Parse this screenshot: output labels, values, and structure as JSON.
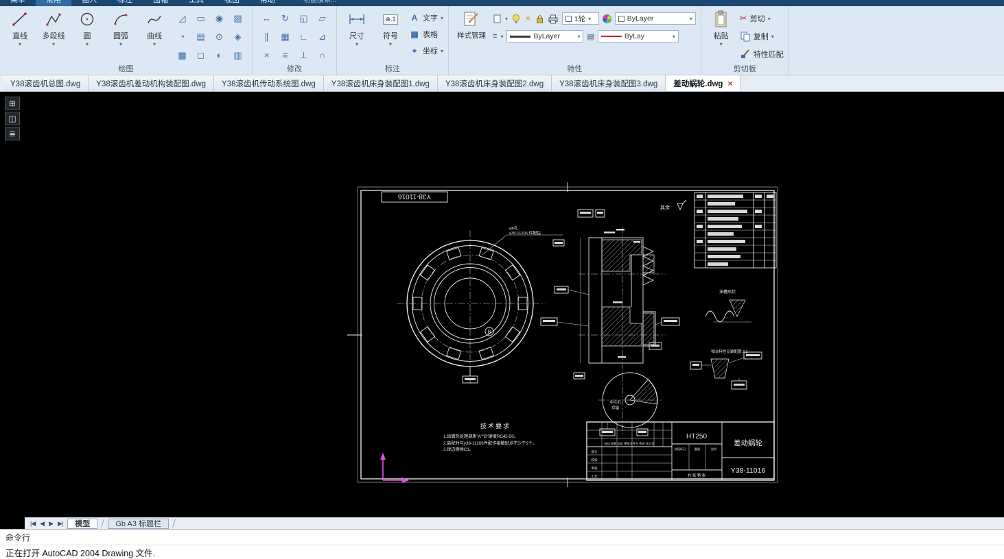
{
  "menu": {
    "items": [
      "菜单",
      "常用",
      "插入",
      "标注",
      "图幅",
      "工具",
      "视图",
      "帮助"
    ],
    "search": "功能搜索..."
  },
  "icons": {
    "dropdown": "▾",
    "close": "×",
    "scissors": "✂",
    "sun": "☀",
    "hamburger": "≡",
    "rows": "▤",
    "text_a": "A",
    "table": "▦",
    "coord": "⌖",
    "symbol": "⊕.1",
    "nav_first": "|◀",
    "nav_prev": "◀",
    "nav_next": "▶",
    "nav_last": "▶|",
    "rail": [
      "⊞",
      "◫",
      "≣"
    ],
    "draw_small": [
      "◿",
      "▭",
      "◉",
      "▨",
      "◔",
      "▤",
      "⊙",
      "◈",
      "▩",
      "◻",
      "◐",
      "▥"
    ],
    "modify_grid": [
      "↔",
      "↻",
      "◱",
      "▱",
      "∥",
      "▦",
      "∟",
      "⊿",
      "×",
      "≡",
      "⊥",
      "∩"
    ]
  },
  "ribbon": {
    "draw": {
      "label": "绘图",
      "big": [
        {
          "label": "直线"
        },
        {
          "label": "多段线"
        },
        {
          "label": "圆"
        },
        {
          "label": "圆弧"
        },
        {
          "label": "曲线"
        }
      ]
    },
    "modify": {
      "label": "修改"
    },
    "annotate": {
      "label": "标注",
      "dim": "尺寸",
      "symbol": "符号",
      "text": "文字",
      "table": "表格",
      "coord": "坐标"
    },
    "props": {
      "label": "特性",
      "style_mgr": "样式管理",
      "layer": "1轮",
      "color": "ByLayer",
      "lineweight": "ByLayer",
      "linetype": "ByLay"
    },
    "clip": {
      "label": "剪切板",
      "paste": "粘贴",
      "cut": "剪切",
      "copy": "复制",
      "match": "特性匹配"
    }
  },
  "doc_tabs": [
    {
      "label": "Y38滚齿机总图.dwg"
    },
    {
      "label": "Y38滚齿机差动机构装配图.dwg"
    },
    {
      "label": "Y38滚齿机传动系统图.dwg"
    },
    {
      "label": "Y38滚齿机床身装配图1.dwg"
    },
    {
      "label": "Y38滚齿机床身装配图2.dwg"
    },
    {
      "label": "Y38滚齿机床身装配图3.dwg"
    },
    {
      "label": "差动蜗轮.dwg",
      "active": true
    }
  ],
  "drawing": {
    "frame_label": "Y38-11016",
    "b_mark": "B",
    "leader": {
      "l1": "φ6孔",
      "l2": "y38-11206 件配钻"
    },
    "surface_note": "其余",
    "oil_groove_label": "油槽形状",
    "detail_label": "啮合特性见装配图 2:1",
    "center_hole": {
      "l1": "中心孔",
      "l2": "保留"
    },
    "tech": {
      "title": "技术要求",
      "l1": "1.齿面热处理调质\"A\"\"B\"硬度RC45-50。",
      "l2": "2.装配时与y38-11206件配作接触斑点不少于2个。",
      "l3": "3.锐边倒角C1。"
    },
    "title_block": {
      "material": "HT250",
      "part_name": "差动蜗轮",
      "drawing_no": "Y38-11016",
      "rev_header": "标记 处数 分区 更改文件号 签名 年月日",
      "r1": "设计",
      "r2": "校核",
      "r3": "审核",
      "r4": "工艺",
      "stage": "阶段标记",
      "weight": "重量",
      "scale": "比例",
      "sheet": "共 张 第 张"
    }
  },
  "bottom": {
    "model_tab": "模型",
    "layout_tab": "Gb A3 标题栏",
    "cmd_label": "命令行",
    "status": "正在打开 AutoCAD 2004 Drawing 文件."
  },
  "colors": {
    "accent_blue": "#1b4771",
    "ribbon_bg": "#dce8f4",
    "canvas_bg": "#000000",
    "drawing_line": "#ededed",
    "ucs_magenta": "#e84fe8",
    "linetype_red": "#cc2222"
  }
}
